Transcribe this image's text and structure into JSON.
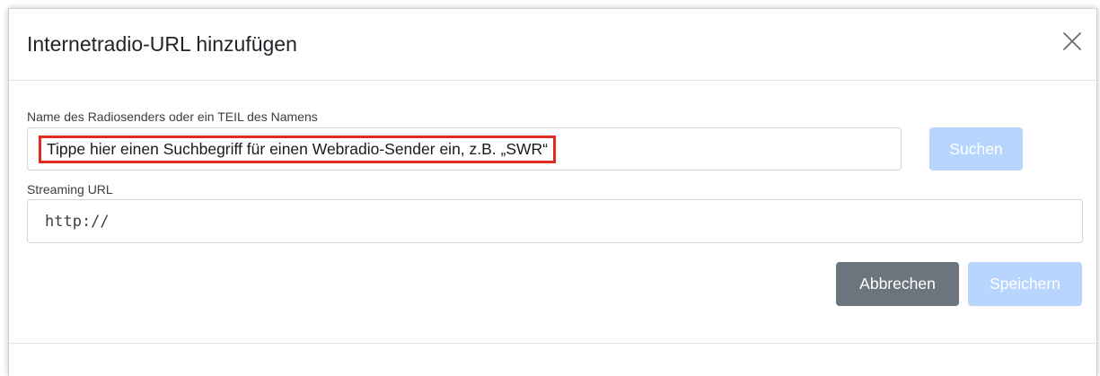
{
  "dialog": {
    "title": "Internetradio-URL hinzufügen",
    "close_icon": "close-icon"
  },
  "form": {
    "name_label": "Name des Radiosenders oder ein TEIL des Namens",
    "name_placeholder": "Tippe hier einen Suchbegriff für einen Webradio-Sender ein, z.B. „SWR“",
    "search_button": "Suchen",
    "url_label": "Streaming URL",
    "url_value": "http://"
  },
  "footer": {
    "cancel_button": "Abbrechen",
    "save_button": "Speichern"
  },
  "colors": {
    "primary_disabled": "#b8d6fd",
    "secondary": "#6c757d",
    "highlight": "#e02b20"
  }
}
